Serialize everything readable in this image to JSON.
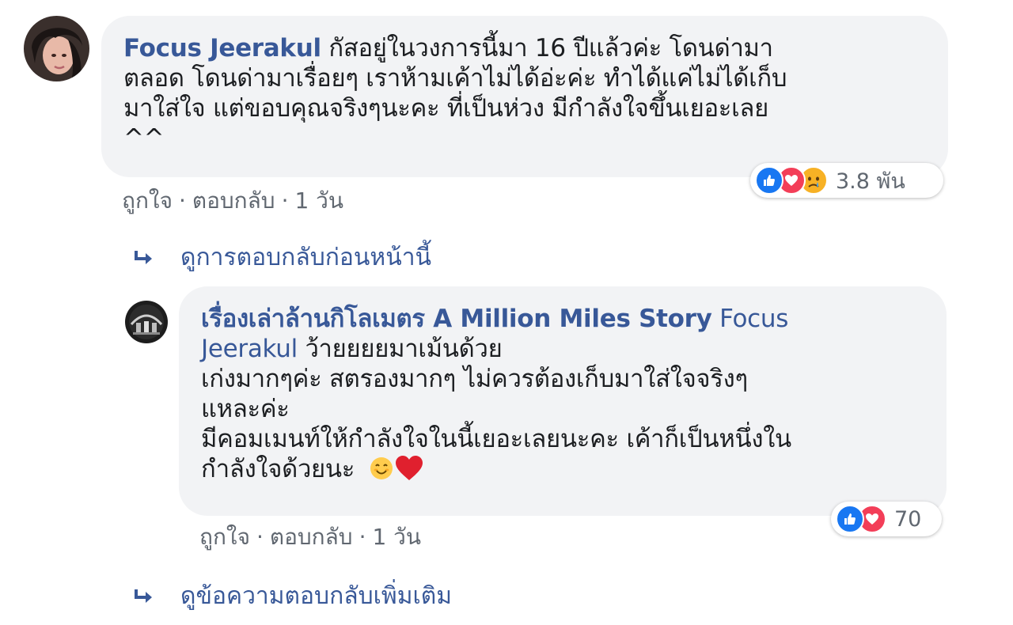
{
  "comment": {
    "author": "Focus Jeerakul",
    "lines": [
      "กัสอยู่ในวงการนี้มา 16 ปีแล้วค่ะ โดนด่ามา",
      "ตลอด โดนด่ามาเรื่อยๆ เราห้ามเค้าไม่ได้อ่ะค่ะ ทำได้แค่ไม่ได้เก็บ",
      "มาใส่ใจ แต่ขอบคุณจริงๆนะคะ ที่เป็นห่วง มีกำลังใจขึ้นเยอะเลย",
      "^^"
    ],
    "reactions": {
      "icons": [
        "like-icon",
        "love-icon",
        "sad-icon"
      ],
      "count": "3.8 พัน"
    },
    "actions": {
      "like": "ถูกใจ",
      "separator": "·",
      "reply": "ตอบกลับ",
      "time": "1 วัน"
    }
  },
  "view_previous_replies": "ดูการตอบกลับก่อนหน้านี้",
  "reply": {
    "author": "เรื่องเล่าล้านกิโลเมตร A Million Miles Story",
    "mention_first": "Focus",
    "mention_second": "Jeerakul",
    "line1_rest": "ว้ายยยยมาเม้นด้วย",
    "lines": [
      "เก่งมากๆค่ะ สตรองมากๆ ไม่ควรต้องเก็บมาใส่ใจจริงๆ",
      "แหละค่ะ",
      "มีคอมเมนท์ให้กำลังใจในนี้เยอะเลยนะคะ เค้าก็เป็นหนึ่งใน"
    ],
    "last_line": "กำลังใจด้วยนะ",
    "emojis": [
      "smile-emoji",
      "heart-emoji"
    ],
    "reactions": {
      "icons": [
        "like-icon",
        "love-icon"
      ],
      "count": "70"
    },
    "actions": {
      "like": "ถูกใจ",
      "separator": "·",
      "reply": "ตอบกลับ",
      "time": "1 วัน"
    }
  },
  "view_more_replies": "ดูข้อความตอบกลับเพิ่มเติม",
  "colors": {
    "link": "#385898",
    "bubble": "#f2f3f5",
    "meta": "#606770",
    "like": "#1877f2",
    "love": "#f33e58",
    "sad": "#f7b125"
  }
}
